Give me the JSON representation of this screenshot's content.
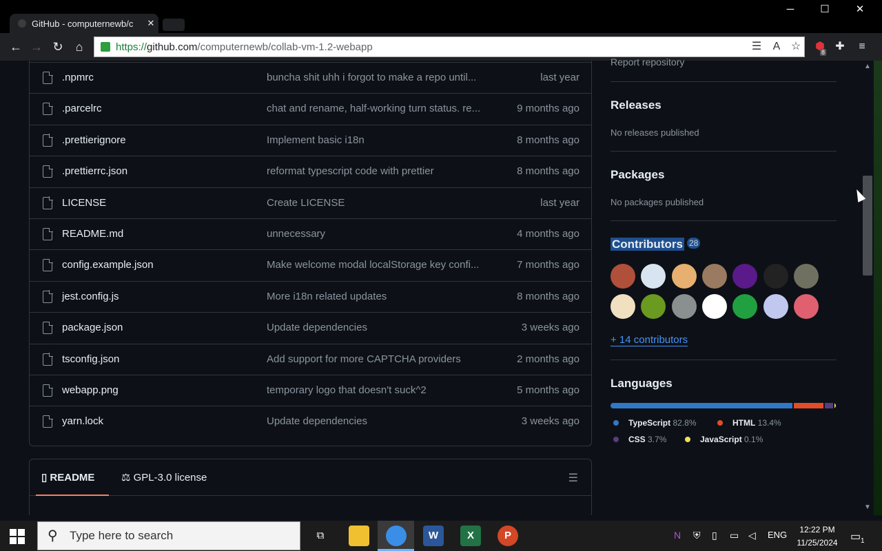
{
  "browser": {
    "tab_title": "GitHub - computernewb/c",
    "tab_close": "✕",
    "url_scheme": "https://",
    "url_host": "github.com",
    "url_path": "/computernewb/collab-vm-1.2-webapp",
    "window_minimize": "─",
    "window_maximize": "☐",
    "window_close": "✕",
    "extension_badge": "8"
  },
  "files": [
    {
      "name": ".npmrc",
      "message": "buncha shit uhh i forgot to make a repo until...",
      "date": "last year"
    },
    {
      "name": ".parcelrc",
      "message": "chat and rename, half-working turn status. re...",
      "date": "9 months ago"
    },
    {
      "name": ".prettierignore",
      "message": "Implement basic i18n",
      "date": "8 months ago"
    },
    {
      "name": ".prettierrc.json",
      "message": "reformat typescript code with prettier",
      "date": "8 months ago"
    },
    {
      "name": "LICENSE",
      "message": "Create LICENSE",
      "date": "last year"
    },
    {
      "name": "README.md",
      "message": "unnecessary",
      "date": "4 months ago"
    },
    {
      "name": "config.example.json",
      "message": "Make welcome modal localStorage key confi...",
      "date": "7 months ago"
    },
    {
      "name": "jest.config.js",
      "message": "More i18n related updates",
      "date": "8 months ago"
    },
    {
      "name": "package.json",
      "message": "Update dependencies",
      "date": "3 weeks ago"
    },
    {
      "name": "tsconfig.json",
      "message": "Add support for more CAPTCHA providers",
      "date": "2 months ago"
    },
    {
      "name": "webapp.png",
      "message": "temporary logo that doesn't suck^2",
      "date": "5 months ago"
    },
    {
      "name": "yarn.lock",
      "message": "Update dependencies",
      "date": "3 weeks ago"
    }
  ],
  "readme": {
    "tab_readme": "README",
    "tab_license": "GPL-3.0 license"
  },
  "sidebar": {
    "report": "Report repository",
    "releases_title": "Releases",
    "releases_text": "No releases published",
    "packages_title": "Packages",
    "packages_text": "No packages published",
    "contributors_title": "Contributors",
    "contributors_count": "28",
    "more_contributors": "+ 14 contributors",
    "languages_title": "Languages",
    "languages": [
      {
        "name": "TypeScript",
        "percent": "82.8%",
        "value": 82.8,
        "color": "#3178c6"
      },
      {
        "name": "HTML",
        "percent": "13.4%",
        "value": 13.4,
        "color": "#e34c26"
      },
      {
        "name": "CSS",
        "percent": "3.7%",
        "value": 3.7,
        "color": "#563d7c"
      },
      {
        "name": "JavaScript",
        "percent": "0.1%",
        "value": 0.1,
        "color": "#f1e05a"
      }
    ],
    "avatar_colors": [
      "#b0503a",
      "#d8e4f0",
      "#e8b070",
      "#9a7a60",
      "#5a1a8a",
      "#222222",
      "#707060",
      "#f0e0c0",
      "#6a9a20",
      "#8a9090",
      "#ffffff",
      "#20a040",
      "#c0c8f0",
      "#e06070"
    ]
  },
  "taskbar": {
    "search_placeholder": "Type here to search",
    "lang": "ENG",
    "time": "12:22 PM",
    "date": "11/25/2024",
    "notification_count": "1"
  }
}
